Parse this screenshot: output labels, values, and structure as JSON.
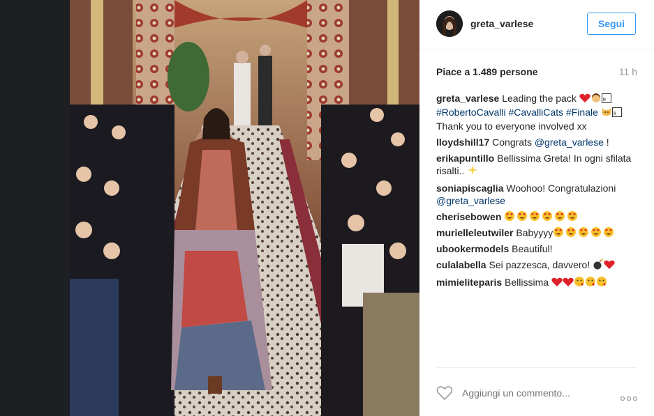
{
  "post": {
    "username": "greta_varlese",
    "follow_label": "Segui",
    "likes_text": "Piace a 1.489 persone",
    "time_ago": "11 h"
  },
  "caption": {
    "user": "greta_varlese",
    "text1": "Leading the pack",
    "hashtags": "#RobertoCavalli #CavalliCats #Finale",
    "text2": "Thank you to everyone involved xx"
  },
  "comments": [
    {
      "user": "lloydshill17",
      "text": "Congrats",
      "mention": "@greta_varlese",
      "after": " !"
    },
    {
      "user": "erikapuntillo",
      "text": "Bellissima Greta! In ogni sfilata risalti.."
    },
    {
      "user": "soniapiscaglia",
      "text": "Woohoo! Congratulazioni",
      "mention": "@greta_varlese"
    },
    {
      "user": "cherisebowen",
      "text": ""
    },
    {
      "user": "murielleleutwiler",
      "text": "Babyyyy"
    },
    {
      "user": "ubookermodels",
      "text": "Beautiful!"
    },
    {
      "user": "culalabella",
      "text": "Sei pazzesca, davvero!"
    },
    {
      "user": "mimieliteparis",
      "text": "Bellissima"
    }
  ],
  "composer": {
    "placeholder": "Aggiungi un commento..."
  },
  "icons": {
    "like": "heart-outline-icon",
    "more": "more-options-icon"
  },
  "colors": {
    "link": "#003569",
    "follow": "#3897f0",
    "heart": "#e0202a"
  }
}
